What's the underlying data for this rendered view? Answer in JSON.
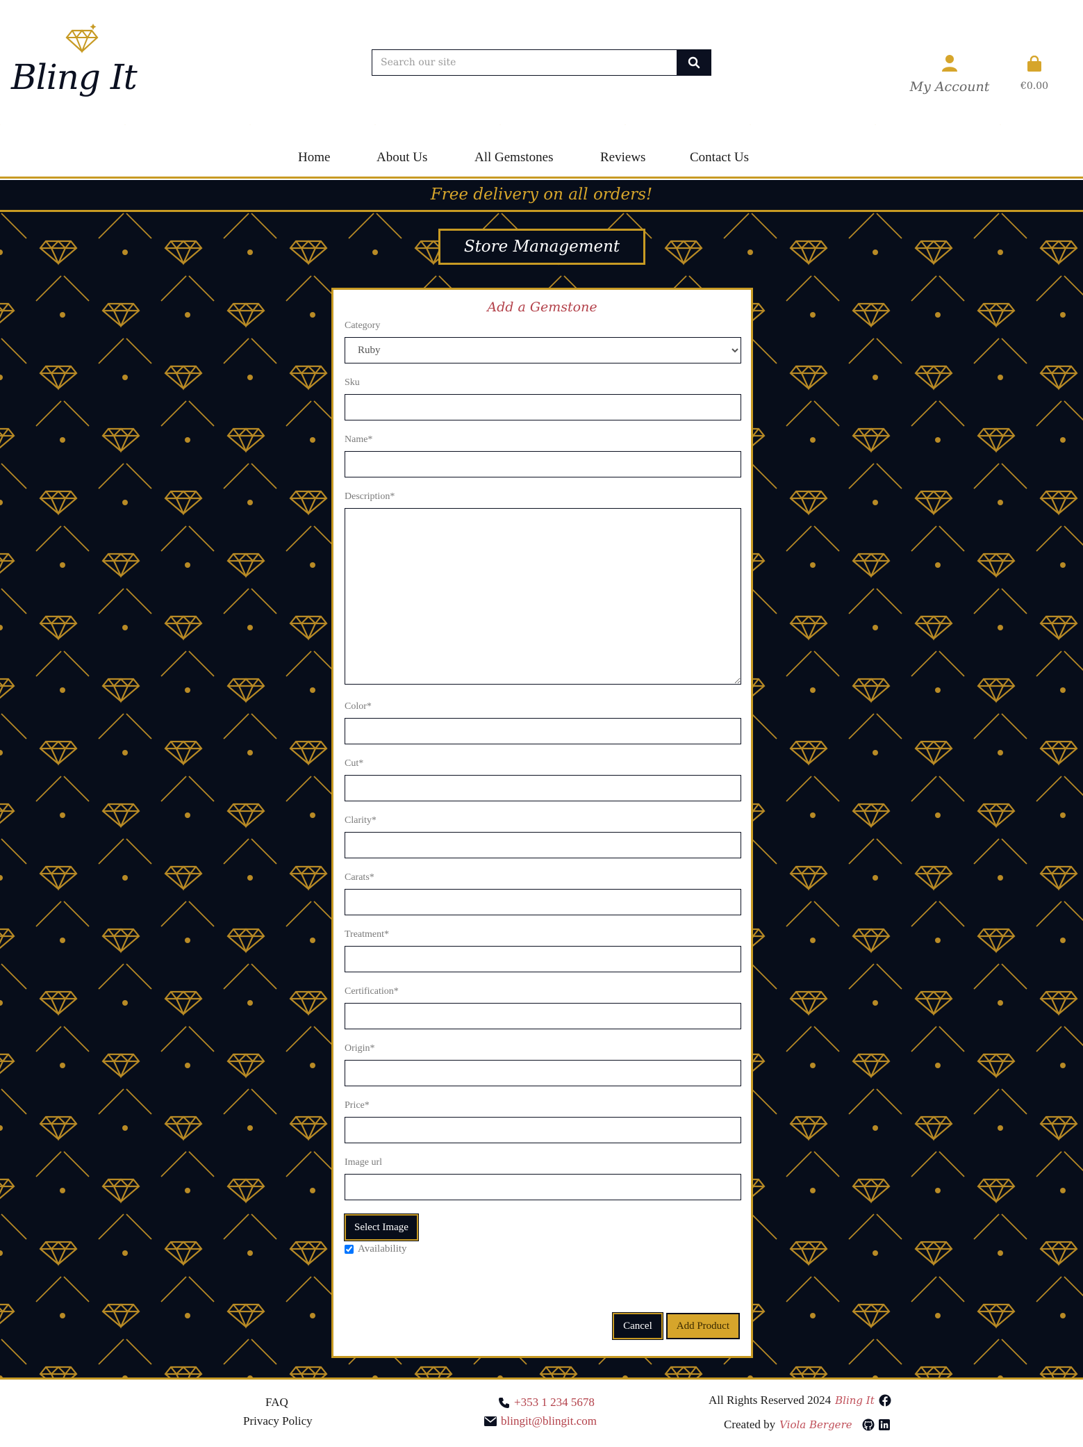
{
  "brand": {
    "name": "Bling It"
  },
  "search": {
    "placeholder": "Search our site"
  },
  "header": {
    "account_label": "My Account",
    "bag_total": "€0.00"
  },
  "nav": {
    "items": [
      "Home",
      "About Us",
      "All Gemstones",
      "Reviews",
      "Contact Us"
    ]
  },
  "banner": {
    "text": "Free delivery on all orders!"
  },
  "page": {
    "title": "Store Management"
  },
  "form": {
    "heading": "Add a Gemstone",
    "category_label": "Category",
    "category_value": "Ruby",
    "sku_label": "Sku",
    "name_label": "Name*",
    "description_label": "Description*",
    "color_label": "Color*",
    "cut_label": "Cut*",
    "clarity_label": "Clarity*",
    "carats_label": "Carats*",
    "treatment_label": "Treatment*",
    "certification_label": "Certification*",
    "origin_label": "Origin*",
    "price_label": "Price*",
    "image_url_label": "Image url",
    "select_image_label": "Select Image",
    "availability_label": "Availability",
    "availability_checked": true,
    "cancel_label": "Cancel",
    "submit_label": "Add Product"
  },
  "footer": {
    "faq": "FAQ",
    "privacy": "Privacy Policy",
    "phone": "+353 1 234 5678",
    "email": "blingit@blingit.com",
    "rights": "All Rights Reserved 2024",
    "rights_brand": "Bling It",
    "created_by": "Created by",
    "author": "Viola Bergere"
  },
  "colors": {
    "navy": "#070d1a",
    "gold": "#c79a23",
    "accent_red": "#b3414a"
  }
}
